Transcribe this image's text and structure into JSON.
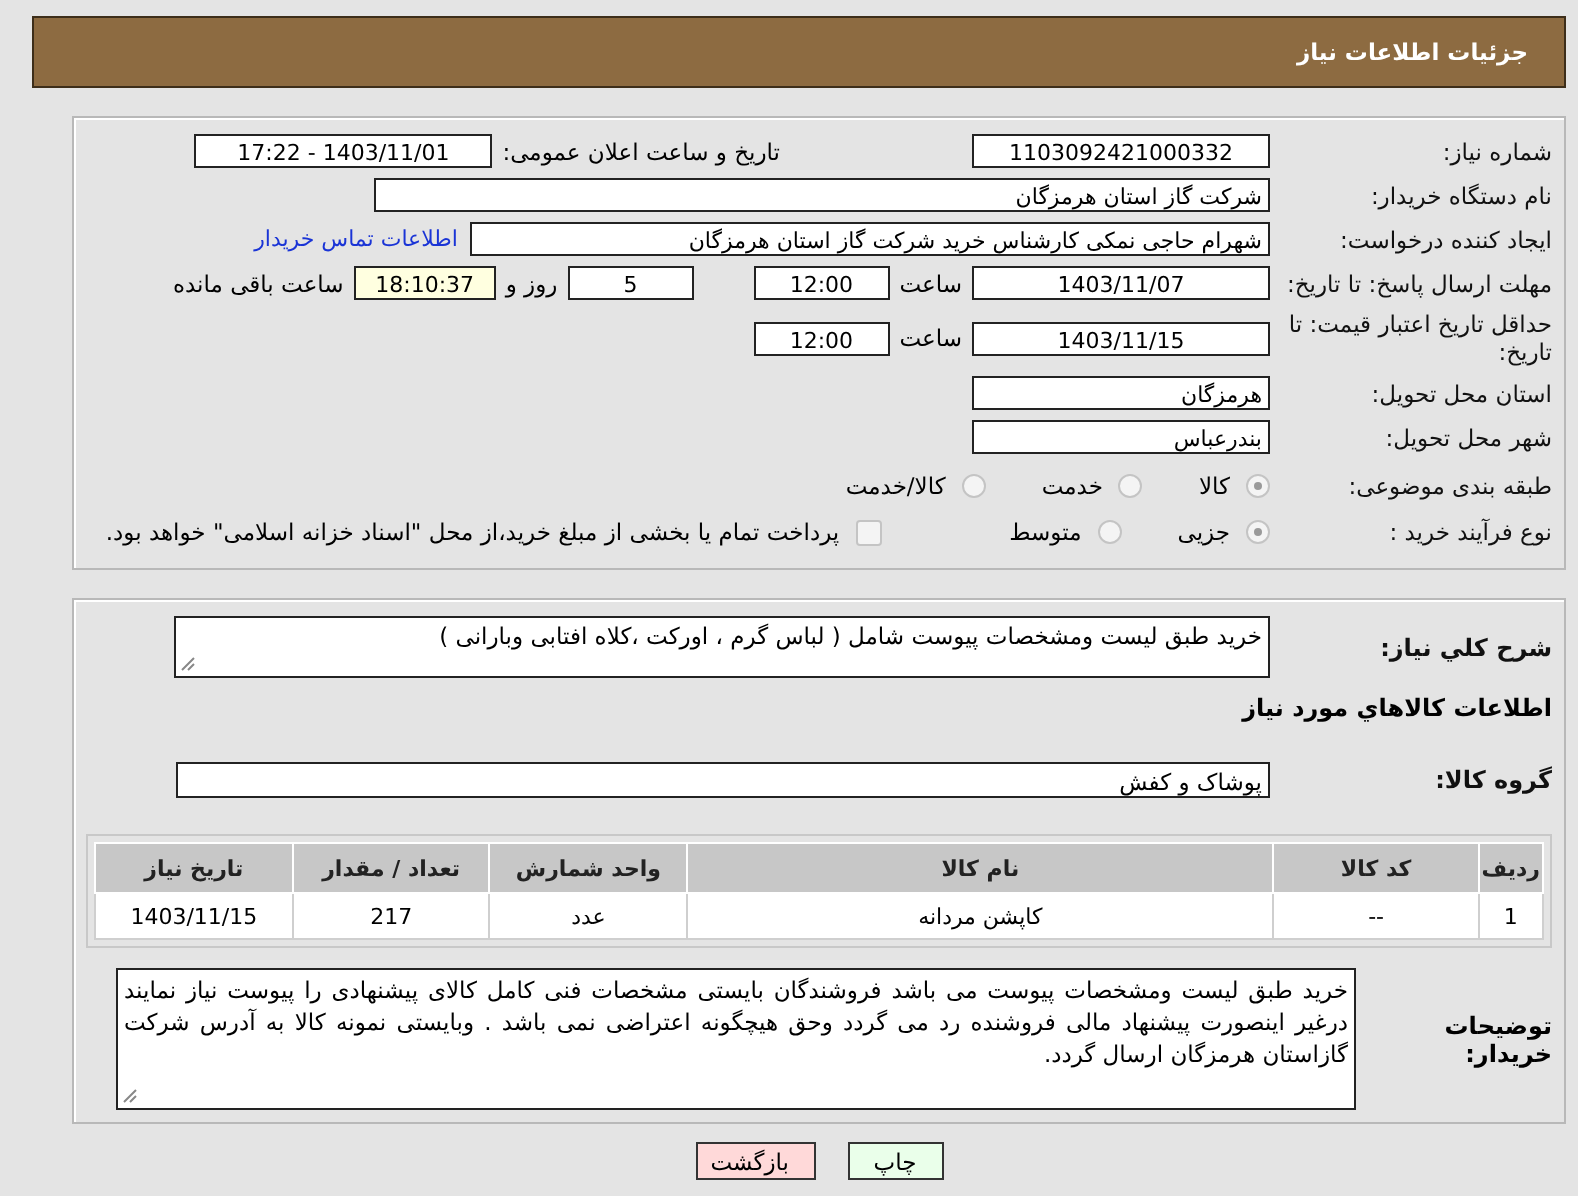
{
  "header": {
    "title": "جزئیات اطلاعات نیاز"
  },
  "details": {
    "need_number": {
      "label": "شماره نیاز:",
      "value": "1103092421000332"
    },
    "announce": {
      "label": "تاریخ و ساعت اعلان عمومی:",
      "value": "1403/11/01 - 17:22"
    },
    "buyer": {
      "label": "نام دستگاه خریدار:",
      "value": "شرکت گاز استان هرمزگان"
    },
    "requester": {
      "label": "ایجاد کننده درخواست:",
      "value": "شهرام حاجی نمکی کارشناس خرید شرکت گاز استان هرمزگان",
      "link": "اطلاعات تماس خریدار"
    },
    "deadline": {
      "label": "مهلت ارسال پاسخ: تا تاریخ:",
      "date": "1403/11/07",
      "time_label": "ساعت",
      "time": "12:00",
      "days": "5",
      "days_label": "روز و",
      "remaining": "18:10:37",
      "remaining_label": "ساعت باقی مانده"
    },
    "validity": {
      "label": "حداقل تاریخ اعتبار قیمت: تا تاریخ:",
      "date": "1403/11/15",
      "time_label": "ساعت",
      "time": "12:00"
    },
    "province": {
      "label": "استان محل تحویل:",
      "value": "هرمزگان"
    },
    "city": {
      "label": "شهر محل تحویل:",
      "value": "بندرعباس"
    },
    "category": {
      "label": "طبقه بندی موضوعی:",
      "options": [
        {
          "label": "کالا",
          "selected": true
        },
        {
          "label": "خدمت",
          "selected": false
        },
        {
          "label": "کالا/خدمت",
          "selected": false
        }
      ]
    },
    "process": {
      "label": "نوع فرآیند خرید :",
      "options": [
        {
          "label": "جزیی",
          "selected": true
        },
        {
          "label": "متوسط",
          "selected": false
        }
      ],
      "treasury": {
        "label": "پرداخت تمام یا بخشی از مبلغ خرید،از محل \"اسناد خزانه اسلامی\" خواهد بود.",
        "checked": false
      }
    }
  },
  "needs": {
    "summary": {
      "label": "شرح کلي نياز:",
      "value": "خرید طبق لیست ومشخصات پیوست شامل ( لباس گرم ، اورکت ،کلاه افتابی وبارانی )"
    },
    "section_title": "اطلاعات کالاهاي مورد نياز",
    "group": {
      "label": "گروه کالا:",
      "value": "پوشاک و کفش"
    },
    "table": {
      "columns": [
        "ردیف",
        "کد کالا",
        "نام کالا",
        "واحد شمارش",
        "تعداد / مقدار",
        "تاریخ نیاز"
      ],
      "rows": [
        [
          "1",
          "--",
          "کاپشن مردانه",
          "عدد",
          "217",
          "1403/11/15"
        ]
      ]
    },
    "notes": {
      "label": "توضیحات خریدار:",
      "value": "خرید طبق لیست ومشخصات پیوست می باشد  فروشندگان بایستی مشخصات فنی کامل کالای پیشنهادی را پیوست نیاز نمایند درغیر اینصورت پیشنهاد مالی فروشنده رد می گردد وحق هیچگونه اعتراضی نمی باشد . وبایستی نمونه کالا به آدرس شرکت گازاستان هرمزگان ارسال گردد."
    }
  },
  "buttons": [
    {
      "label": "چاپ",
      "kind": "print"
    },
    {
      "label": "بازگشت",
      "kind": "back"
    }
  ]
}
